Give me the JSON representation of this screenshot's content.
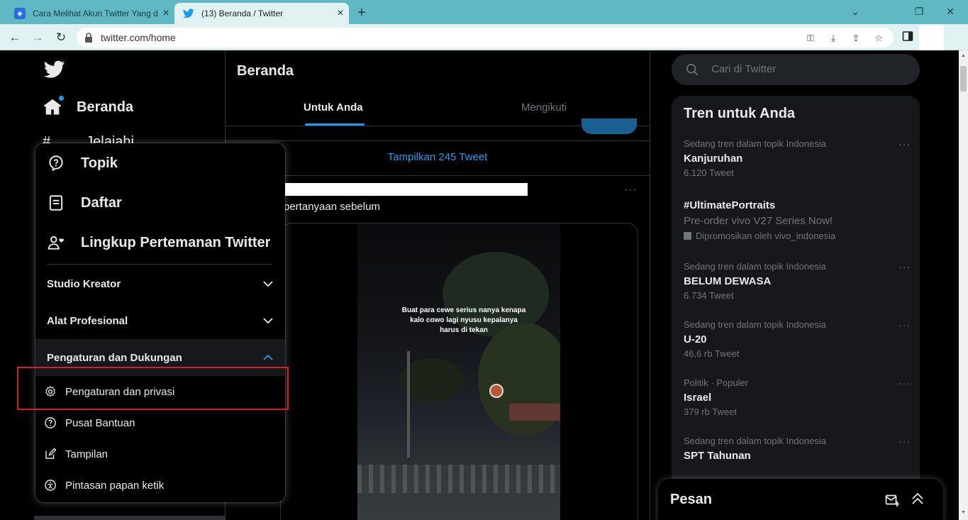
{
  "browser": {
    "tabs": [
      {
        "title": "Cara Melihat Akun Twitter Yang d",
        "active": false
      },
      {
        "title": "(13) Beranda / Twitter",
        "active": true
      }
    ],
    "url": "twitter.com/home",
    "win_controls": {
      "minimize": "⌄",
      "restore": "❐",
      "close": "✕"
    }
  },
  "nav": {
    "home_label": "Beranda",
    "explore_label": "Jelajahi"
  },
  "menu": {
    "items": [
      {
        "label": "Topik",
        "icon": "topics-icon"
      },
      {
        "label": "Daftar",
        "icon": "lists-icon"
      },
      {
        "label": "Lingkup Pertemanan Twitter",
        "icon": "circle-icon"
      }
    ],
    "accordions": [
      {
        "label": "Studio Kreator",
        "expanded": false
      },
      {
        "label": "Alat Profesional",
        "expanded": false
      },
      {
        "label": "Pengaturan dan Dukungan",
        "expanded": true
      }
    ],
    "subitems": [
      {
        "label": "Pengaturan dan privasi",
        "icon": "gear-icon",
        "highlighted": true
      },
      {
        "label": "Pusat Bantuan",
        "icon": "help-icon"
      },
      {
        "label": "Tampilan",
        "icon": "edit-icon"
      },
      {
        "label": "Pintasan papan ketik",
        "icon": "accessibility-icon"
      }
    ]
  },
  "center": {
    "title": "Beranda",
    "tabs": [
      "Untuk Anda",
      "Mengikuti"
    ],
    "show_tweets": "Tampilkan 245 Tweet",
    "tweet_text": "pertanyaan sebelum",
    "video_caption": "Buat para cewe serius nanya kenapa kalo cowo lagi nyusu kepalanya harus di tekan"
  },
  "right": {
    "search_placeholder": "Cari di Twitter",
    "trends_title": "Tren untuk Anda",
    "trends": [
      {
        "context": "Sedang tren dalam topik Indonesia",
        "name": "Kanjuruhan",
        "count": "6.120 Tweet"
      },
      {
        "name": "#UltimatePortraits",
        "description": "Pre-order vivo V27 Series Now!",
        "promoted": "Dipromosikan oleh vivo_indonesia"
      },
      {
        "context": "Sedang tren dalam topik Indonesia",
        "name": "BELUM DEWASA",
        "count": "6.734 Tweet"
      },
      {
        "context": "Sedang tren dalam topik Indonesia",
        "name": "U-20",
        "count": "46,6 rb Tweet"
      },
      {
        "context": "Politik · Populer",
        "name": "Israel",
        "count": "379 rb Tweet"
      },
      {
        "context": "Sedang tren dalam topik Indonesia",
        "name": "SPT Tahunan",
        "count": ""
      }
    ],
    "messages_label": "Pesan"
  },
  "colors": {
    "accent": "#1d9bf0",
    "highlight": "#d31f26",
    "tabbar": "#5fb8c4"
  }
}
